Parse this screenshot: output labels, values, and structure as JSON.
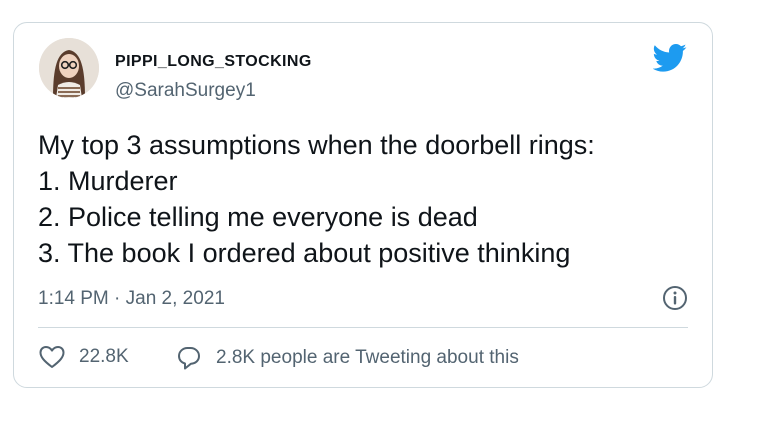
{
  "author": {
    "display_name": "PIPPI_LONG_STOCKING",
    "handle": "@SarahSurgey1"
  },
  "tweet": {
    "lines": [
      "My top 3 assumptions when the doorbell rings:",
      "1. Murderer",
      "2. Police telling me everyone is dead",
      "3. The book I ordered about positive thinking"
    ],
    "timestamp": "1:14 PM · Jan 2, 2021"
  },
  "actions": {
    "likes": "22.8K",
    "conversation": "2.8K people are Tweeting about this"
  },
  "icons": {
    "logo": "twitter-bird-icon",
    "info": "info-icon",
    "like": "heart-icon",
    "reply": "speech-bubble-icon"
  },
  "colors": {
    "brand": "#1d9bf0",
    "text": "#0f1419",
    "secondary": "#536471",
    "border": "#cfd9de"
  }
}
